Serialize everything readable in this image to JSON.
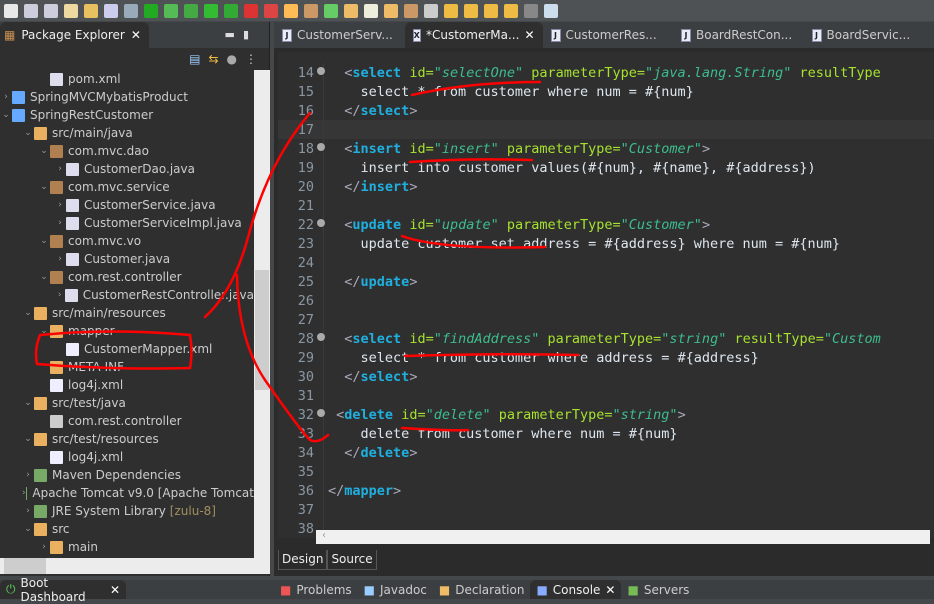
{
  "colors": {
    "tag": "#1fb0e0",
    "attr": "#a6e22e",
    "value": "#3dbd8f",
    "text": "#dde6ee",
    "annotation": "#ff0000"
  },
  "toolbar": {
    "icons": [
      "new-icon",
      "save-icon",
      "save-all-icon",
      "open-type-icon",
      "open-resource-icon",
      "console-icon",
      "skip-breakpoints-icon",
      "boot-icon",
      "spring-update-icon",
      "debug-icon",
      "run-icon",
      "run-server-icon",
      "stop-icon",
      "external-tools-icon",
      "new-java-project-icon",
      "new-package-icon",
      "new-class-icon",
      "open-project-icon",
      "task-icon",
      "pen-icon",
      "folder-icon",
      "hierarchy-icon",
      "next-annotation-icon",
      "prev-annotation-icon",
      "back-icon",
      "forward-icon",
      "forward-disabled-icon",
      "perspective-icon"
    ]
  },
  "explorer": {
    "title": "Package Explorer",
    "items": [
      {
        "label": "pom.xml",
        "indent": 2,
        "arrow": "",
        "icon": "maven-pom-icon"
      },
      {
        "label": "SpringMVCMybatisProduct",
        "indent": 0,
        "arrow": "›",
        "icon": "spring-project-icon"
      },
      {
        "label": "SpringRestCustomer",
        "indent": 0,
        "arrow": "⌄",
        "icon": "spring-project-icon"
      },
      {
        "label": "src/main/java",
        "indent": 1,
        "arrow": "⌄",
        "icon": "source-folder-icon"
      },
      {
        "label": "com.mvc.dao",
        "indent": 2,
        "arrow": "⌄",
        "icon": "package-icon"
      },
      {
        "label": "CustomerDao.java",
        "indent": 3,
        "arrow": "›",
        "icon": "java-interface-icon"
      },
      {
        "label": "com.mvc.service",
        "indent": 2,
        "arrow": "⌄",
        "icon": "package-icon"
      },
      {
        "label": "CustomerService.java",
        "indent": 3,
        "arrow": "›",
        "icon": "java-interface-icon"
      },
      {
        "label": "CustomerServiceImpl.java",
        "indent": 3,
        "arrow": "›",
        "icon": "java-spring-icon"
      },
      {
        "label": "com.mvc.vo",
        "indent": 2,
        "arrow": "⌄",
        "icon": "package-icon"
      },
      {
        "label": "Customer.java",
        "indent": 3,
        "arrow": "›",
        "icon": "java-file-icon"
      },
      {
        "label": "com.rest.controller",
        "indent": 2,
        "arrow": "⌄",
        "icon": "package-icon"
      },
      {
        "label": "CustomerRestController.java",
        "indent": 3,
        "arrow": "›",
        "icon": "java-spring-icon"
      },
      {
        "label": "src/main/resources",
        "indent": 1,
        "arrow": "⌄",
        "icon": "source-folder-icon"
      },
      {
        "label": "mapper",
        "indent": 2,
        "arrow": "⌄",
        "icon": "folder-icon"
      },
      {
        "label": "CustomerMapper.xml",
        "indent": 3,
        "arrow": "",
        "icon": "xml-file-icon"
      },
      {
        "label": "META-INF",
        "indent": 2,
        "arrow": "",
        "icon": "folder-icon"
      },
      {
        "label": "log4j.xml",
        "indent": 2,
        "arrow": "",
        "icon": "xml-file-icon"
      },
      {
        "label": "src/test/java",
        "indent": 1,
        "arrow": "⌄",
        "icon": "source-folder-icon"
      },
      {
        "label": "com.rest.controller",
        "indent": 2,
        "arrow": "",
        "icon": "empty-package-icon"
      },
      {
        "label": "src/test/resources",
        "indent": 1,
        "arrow": "⌄",
        "icon": "source-folder-icon"
      },
      {
        "label": "log4j.xml",
        "indent": 2,
        "arrow": "",
        "icon": "xml-file-icon"
      },
      {
        "label": "Maven Dependencies",
        "indent": 1,
        "arrow": "›",
        "icon": "library-icon"
      },
      {
        "label": "Apache Tomcat v9.0 [Apache Tomcat",
        "indent": 1,
        "arrow": "›",
        "icon": "library-icon"
      },
      {
        "label": "JRE System Library",
        "decoration": "[zulu-8]",
        "indent": 1,
        "arrow": "›",
        "icon": "library-icon"
      },
      {
        "label": "src",
        "indent": 1,
        "arrow": "⌄",
        "icon": "folder-icon"
      },
      {
        "label": "main",
        "indent": 2,
        "arrow": "›",
        "icon": "folder-icon"
      }
    ]
  },
  "editor": {
    "tabs": [
      {
        "label": "CustomerServ...",
        "icon": "J",
        "active": false
      },
      {
        "label": "*CustomerMa...",
        "icon": "X",
        "active": true
      },
      {
        "label": "CustomerRes...",
        "icon": "J",
        "active": false
      },
      {
        "label": "BoardRestCon...",
        "icon": "J",
        "active": false
      },
      {
        "label": "BoardServic...",
        "icon": "J",
        "active": false
      }
    ],
    "lines": [
      {
        "n": "14",
        "fold": true,
        "tokens": [
          [
            "  ",
            "txt"
          ],
          [
            "<",
            "b"
          ],
          [
            "select",
            "tag"
          ],
          [
            " id=",
            "attr"
          ],
          [
            "\"selectOne\"",
            "val"
          ],
          [
            " parameterType=",
            "attr"
          ],
          [
            "\"java.lang.String\"",
            "val"
          ],
          [
            " resultType",
            "attr"
          ]
        ]
      },
      {
        "n": "15",
        "tokens": [
          [
            "    select * from customer where num = #{num}",
            "txt"
          ]
        ]
      },
      {
        "n": "16",
        "tokens": [
          [
            "  ",
            "txt"
          ],
          [
            "</",
            "b"
          ],
          [
            "select",
            "tag"
          ],
          [
            ">",
            "b"
          ]
        ]
      },
      {
        "n": "17",
        "cur": true,
        "tokens": []
      },
      {
        "n": "18",
        "fold": true,
        "tokens": [
          [
            "  ",
            "txt"
          ],
          [
            "<",
            "b"
          ],
          [
            "insert",
            "tag"
          ],
          [
            " id=",
            "attr"
          ],
          [
            "\"insert\"",
            "val"
          ],
          [
            " parameterType=",
            "attr"
          ],
          [
            "\"Customer\"",
            "val"
          ],
          [
            ">",
            "b"
          ]
        ]
      },
      {
        "n": "19",
        "tokens": [
          [
            "    insert into customer values(#{num}, #{name}, #{address})",
            "txt"
          ]
        ]
      },
      {
        "n": "20",
        "tokens": [
          [
            "  ",
            "txt"
          ],
          [
            "</",
            "b"
          ],
          [
            "insert",
            "tag"
          ],
          [
            ">",
            "b"
          ]
        ]
      },
      {
        "n": "21",
        "tokens": []
      },
      {
        "n": "22",
        "fold": true,
        "tokens": [
          [
            "  ",
            "txt"
          ],
          [
            "<",
            "b"
          ],
          [
            "update",
            "tag"
          ],
          [
            " id=",
            "attr"
          ],
          [
            "\"update\"",
            "val"
          ],
          [
            " parameterType=",
            "attr"
          ],
          [
            "\"Customer\"",
            "val"
          ],
          [
            ">",
            "b"
          ]
        ]
      },
      {
        "n": "23",
        "tokens": [
          [
            "    update customer set address = #{address} where num = #{num}",
            "txt"
          ]
        ]
      },
      {
        "n": "24",
        "tokens": []
      },
      {
        "n": "25",
        "tokens": [
          [
            "  ",
            "txt"
          ],
          [
            "</",
            "b"
          ],
          [
            "update",
            "tag"
          ],
          [
            ">",
            "b"
          ]
        ]
      },
      {
        "n": "26",
        "tokens": []
      },
      {
        "n": "27",
        "tokens": []
      },
      {
        "n": "28",
        "fold": true,
        "tokens": [
          [
            "  ",
            "txt"
          ],
          [
            "<",
            "b"
          ],
          [
            "select",
            "tag"
          ],
          [
            " id=",
            "attr"
          ],
          [
            "\"findAddress\"",
            "val"
          ],
          [
            " parameterType=",
            "attr"
          ],
          [
            "\"string\"",
            "val"
          ],
          [
            " resultType=",
            "attr"
          ],
          [
            "\"Custom",
            "val"
          ]
        ]
      },
      {
        "n": "29",
        "tokens": [
          [
            "    select * from customer where address = #{address}",
            "txt"
          ]
        ]
      },
      {
        "n": "30",
        "tokens": [
          [
            "  ",
            "txt"
          ],
          [
            "</",
            "b"
          ],
          [
            "select",
            "tag"
          ],
          [
            ">",
            "b"
          ]
        ]
      },
      {
        "n": "31",
        "tokens": []
      },
      {
        "n": "32",
        "fold": true,
        "tokens": [
          [
            " ",
            "txt"
          ],
          [
            "<",
            "b"
          ],
          [
            "delete",
            "tag"
          ],
          [
            " id=",
            "attr"
          ],
          [
            "\"delete\"",
            "val"
          ],
          [
            " parameterType=",
            "attr"
          ],
          [
            "\"string\"",
            "val"
          ],
          [
            ">",
            "b"
          ]
        ]
      },
      {
        "n": "33",
        "tokens": [
          [
            "    delete from customer where num = #{num}",
            "txt"
          ]
        ]
      },
      {
        "n": "34",
        "tokens": [
          [
            "  ",
            "txt"
          ],
          [
            "</",
            "b"
          ],
          [
            "delete",
            "tag"
          ],
          [
            ">",
            "b"
          ]
        ]
      },
      {
        "n": "35",
        "tokens": []
      },
      {
        "n": "36",
        "tokens": [
          [
            "</",
            "b"
          ],
          [
            "mapper",
            "tag"
          ],
          [
            ">",
            "b"
          ]
        ]
      },
      {
        "n": "37",
        "tokens": []
      },
      {
        "n": "38",
        "tokens": []
      }
    ],
    "bottom_tabs": [
      "Design",
      "Source"
    ],
    "hscroll_arrow": "‹"
  },
  "boot_dashboard": {
    "title": "Boot Dashboard"
  },
  "bottom_panel": {
    "tabs": [
      {
        "label": "Problems",
        "icon": "problems-icon",
        "active": false
      },
      {
        "label": "Javadoc",
        "icon": "javadoc-icon",
        "active": false
      },
      {
        "label": "Declaration",
        "icon": "declaration-icon",
        "active": false
      },
      {
        "label": "Console",
        "icon": "console-icon",
        "active": true
      },
      {
        "label": "Servers",
        "icon": "servers-icon",
        "active": false
      }
    ]
  }
}
